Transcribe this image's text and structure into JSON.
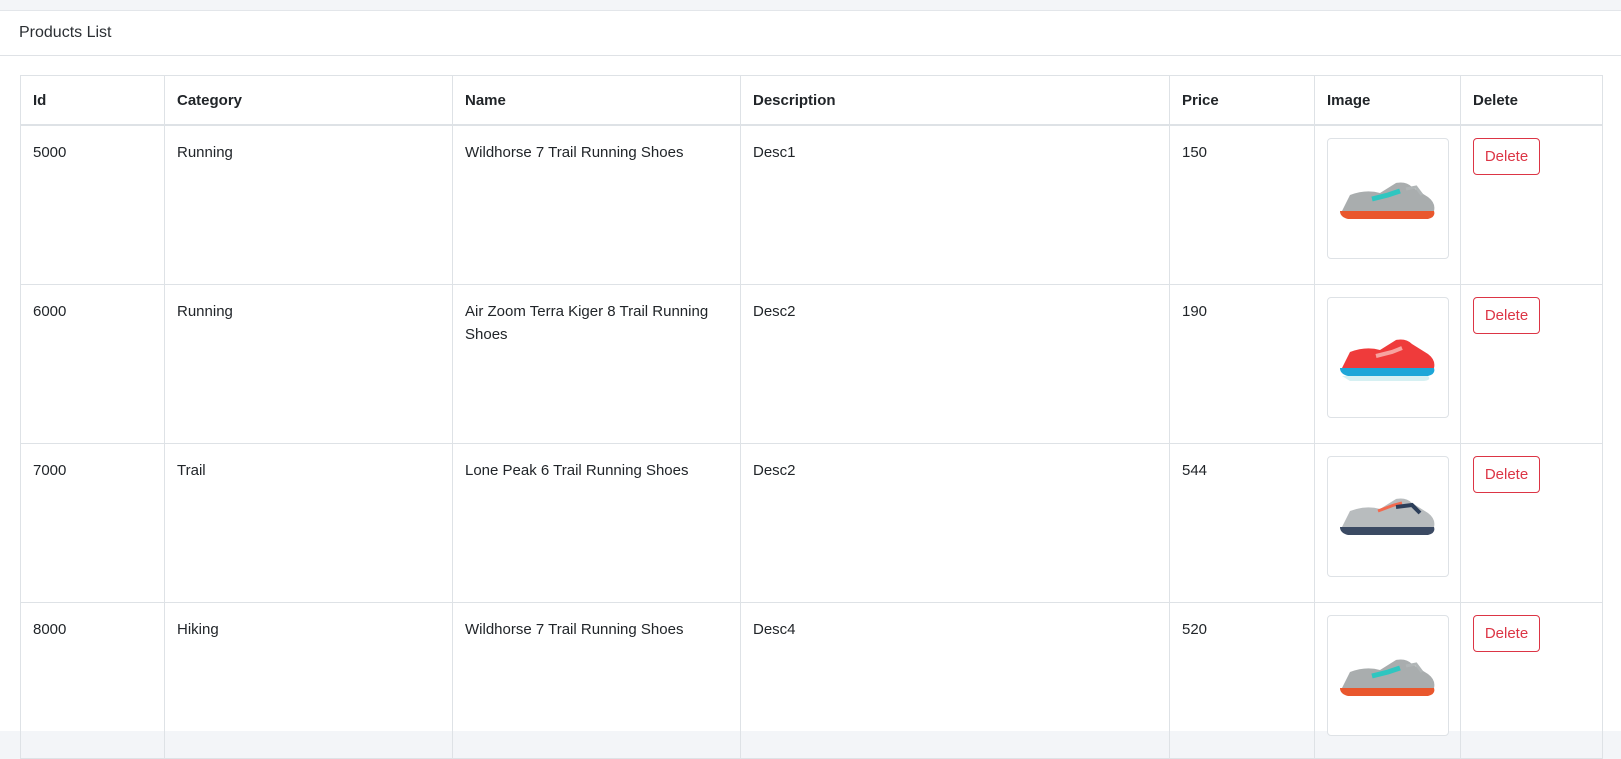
{
  "page": {
    "title": "Products List"
  },
  "table": {
    "headers": [
      "Id",
      "Category",
      "Name",
      "Description",
      "Price",
      "Image",
      "Delete"
    ],
    "rows": [
      {
        "id": "5000",
        "category": "Running",
        "name": "Wildhorse 7 Trail Running Shoes",
        "description": "Desc1",
        "price": "150",
        "image_icon": "shoe-gray-teal-orange",
        "delete_label": "Delete"
      },
      {
        "id": "6000",
        "category": "Running",
        "name": "Air Zoom Terra Kiger 8 Trail Running Shoes",
        "description": "Desc2",
        "price": "190",
        "image_icon": "shoe-red-blue",
        "delete_label": "Delete"
      },
      {
        "id": "7000",
        "category": "Trail",
        "name": "Lone Peak 6 Trail Running Shoes",
        "description": "Desc2",
        "price": "544",
        "image_icon": "shoe-gray-navy",
        "delete_label": "Delete"
      },
      {
        "id": "8000",
        "category": "Hiking",
        "name": "Wildhorse 7 Trail Running Shoes",
        "description": "Desc4",
        "price": "520",
        "image_icon": "shoe-gray-teal-orange",
        "delete_label": "Delete"
      }
    ]
  },
  "colors": {
    "danger": "#dc3545",
    "border": "#dee2e6",
    "background": "#f3f5f8"
  }
}
